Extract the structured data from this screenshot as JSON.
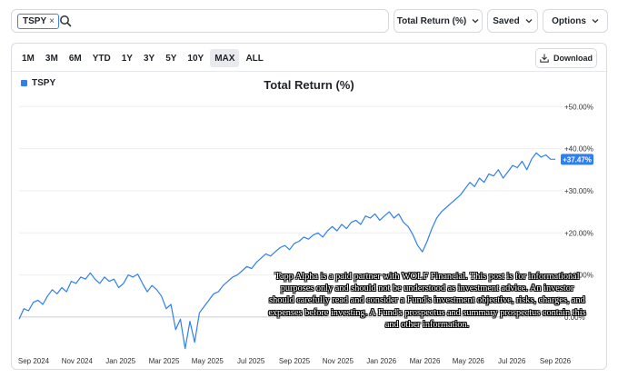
{
  "search": {
    "ticker": "TSPY",
    "remove": "×"
  },
  "toolbar": {
    "metric": "Total Return (%)",
    "saved": "Saved",
    "options": "Options"
  },
  "ranges": [
    "1M",
    "3M",
    "6M",
    "YTD",
    "1Y",
    "3Y",
    "5Y",
    "10Y",
    "MAX",
    "ALL"
  ],
  "active_range": "MAX",
  "download_label": "Download",
  "colors": {
    "series": "#2f7fef",
    "accent": "#3b82f6"
  },
  "chart_data": {
    "type": "line",
    "title": "Total Return (%)",
    "legend": "TSPY",
    "y_ticks": [
      "+50.00%",
      "+40.00%",
      "+30.00%",
      "+20.00%",
      "+10.00%",
      "0.00%"
    ],
    "y_tick_values": [
      50,
      40,
      30,
      20,
      10,
      0
    ],
    "ylim": [
      -8,
      52
    ],
    "x_ticks": [
      "Sep 2024",
      "Nov 2024",
      "Jan 2025",
      "Mar 2025",
      "May 2025",
      "Jul 2025",
      "Sep 2025",
      "Nov 2025",
      "Jan 2026",
      "Mar 2026",
      "May 2026",
      "Jul 2026",
      "Sep 2026"
    ],
    "last_value_label": "+37.47%",
    "last_value": 37.47,
    "series": [
      {
        "name": "TSPY",
        "values": [
          -0.5,
          2.0,
          1.5,
          3.5,
          4.0,
          3.0,
          5.0,
          6.5,
          5.5,
          7.0,
          6.0,
          8.5,
          8.0,
          9.5,
          9.0,
          10.5,
          9.0,
          8.0,
          9.5,
          8.5,
          9.0,
          7.0,
          8.0,
          10.0,
          9.5,
          10.2,
          8.0,
          6.0,
          7.5,
          6.5,
          5.0,
          2.0,
          3.0,
          -3.0,
          -0.5,
          -7.5,
          -1.0,
          -6.0,
          1.0,
          2.5,
          4.0,
          5.5,
          6.0,
          7.5,
          8.5,
          9.5,
          10.0,
          11.0,
          12.0,
          11.5,
          13.0,
          14.0,
          15.0,
          14.5,
          15.5,
          16.5,
          17.0,
          16.0,
          17.5,
          18.0,
          19.0,
          18.5,
          19.5,
          20.0,
          19.0,
          20.5,
          21.5,
          20.5,
          22.0,
          21.0,
          22.5,
          23.0,
          22.0,
          24.0,
          23.5,
          24.5,
          23.0,
          24.0,
          25.0,
          23.5,
          24.5,
          22.5,
          21.5,
          19.5,
          17.0,
          15.5,
          18.0,
          21.0,
          23.5,
          25.0,
          26.0,
          27.0,
          28.0,
          29.0,
          30.5,
          32.0,
          31.0,
          33.0,
          32.0,
          34.0,
          33.5,
          35.0,
          33.0,
          34.5,
          36.0,
          35.5,
          37.0,
          35.0,
          37.5,
          39.0,
          38.0,
          38.5,
          37.5,
          37.47
        ]
      }
    ]
  },
  "disclaimer": "Tapp Alpha is a paid partner with WOLF Financial. This post is for informational purposes only and should not be understood as investment advice. An investor should carefully read and consider a Fund's investment objective, risks, charges, and expenses before investing. A Fund's prospectus and summary prospectus contain this and other information."
}
